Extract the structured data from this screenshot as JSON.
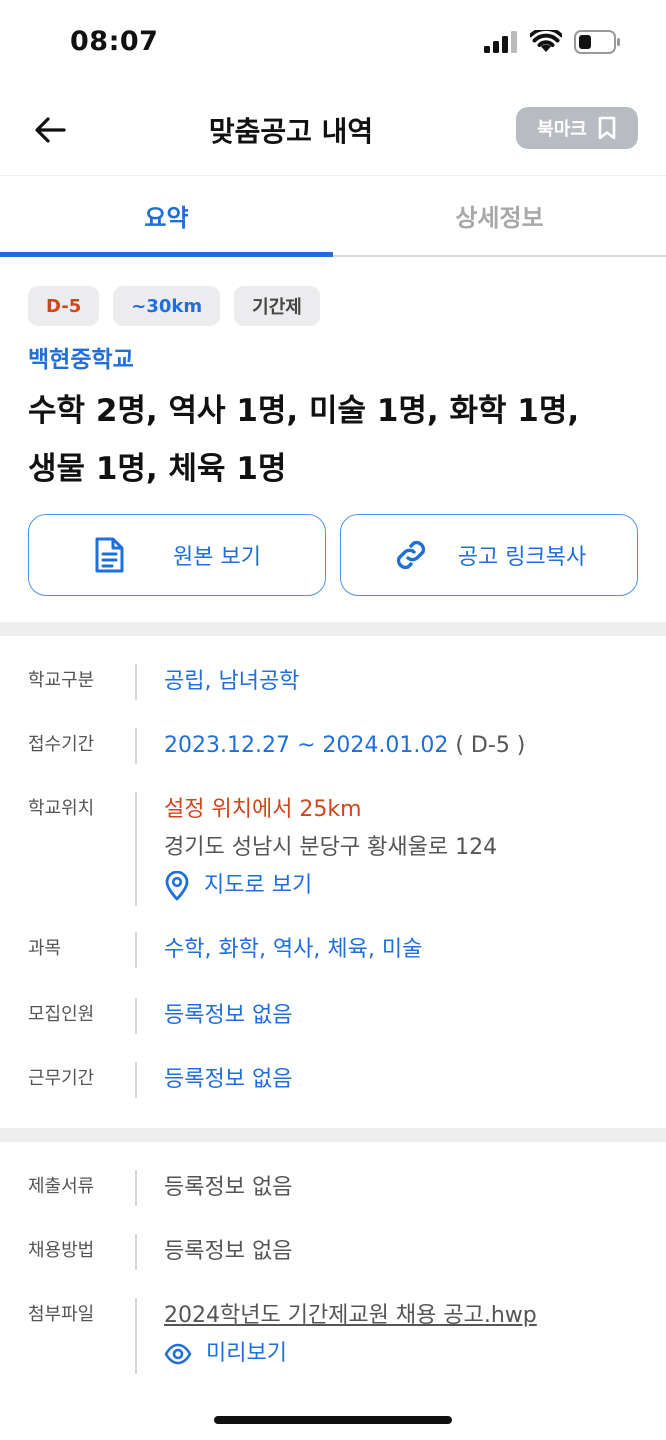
{
  "status": {
    "time": "08:07"
  },
  "nav": {
    "title": "맞춤공고 내역",
    "bookmark_label": "북마크"
  },
  "tabs": [
    {
      "label": "요약",
      "active": true
    },
    {
      "label": "상세정보",
      "active": false
    }
  ],
  "summary": {
    "chips": [
      "D-5",
      "~30km",
      "기간제"
    ],
    "school": "백현중학교",
    "title_line1": "수학 2명, 역사 1명, 미술 1명, 화학 1명,",
    "title_line2": "생물 1명, 체육 1명",
    "view_original_label": "원본 보기",
    "copy_link_label": "공고 링크복사"
  },
  "info": {
    "school_type": {
      "label": "학교구분",
      "value": "공립, 남녀공학"
    },
    "application_period": {
      "label": "접수기간",
      "value": "2023.12.27 ~ 2024.01.02",
      "dday": "( D-5 )"
    },
    "location": {
      "label": "학교위치",
      "distance": "설정 위치에서 25km",
      "address": "경기도 성남시 분당구 황새울로 124",
      "map_link": "지도로 보기"
    },
    "subjects": {
      "label": "과목",
      "value": "수학, 화학, 역사, 체육, 미술"
    },
    "recruit_count": {
      "label": "모집인원",
      "value": "등록정보 없음"
    },
    "work_period": {
      "label": "근무기간",
      "value": "등록정보 없음"
    }
  },
  "docs": {
    "documents": {
      "label": "제출서류",
      "value": "등록정보 없음"
    },
    "hiring_method": {
      "label": "채용방법",
      "value": "등록정보 없음"
    },
    "attachment": {
      "label": "첨부파일",
      "filename": "2024학년도 기간제교원 채용 공고.hwp",
      "preview": "미리보기"
    }
  },
  "colors": {
    "accent": "#1e6fdc",
    "warning": "#d2451b",
    "chip_bg": "#ececef",
    "bookmark_bg": "#b8bcc2"
  },
  "icons": [
    "back-arrow-icon",
    "bookmark-icon",
    "document-icon",
    "link-icon",
    "location-pin-icon",
    "eye-icon",
    "signal-icon",
    "wifi-icon",
    "battery-icon"
  ]
}
